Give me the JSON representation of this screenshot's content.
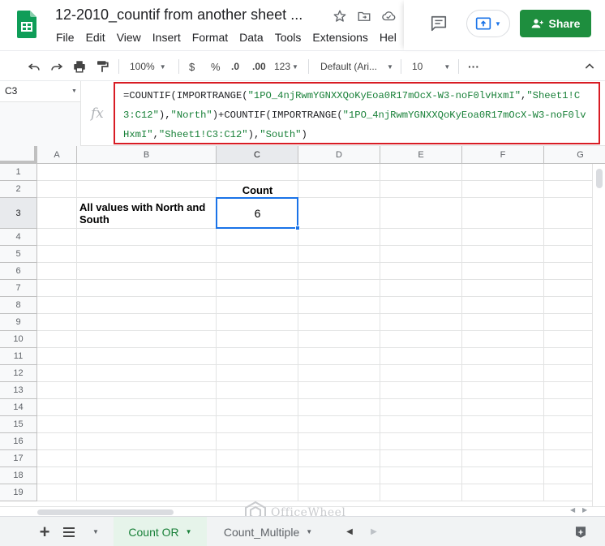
{
  "header": {
    "title": "12-2010_countif from another sheet ...",
    "menu": [
      "File",
      "Edit",
      "View",
      "Insert",
      "Format",
      "Data",
      "Tools",
      "Extensions",
      "Hel"
    ],
    "share_label": "Share",
    "icons": [
      "star-icon",
      "move-to-folder-icon",
      "cloud-status-icon",
      "comment-icon",
      "present-icon",
      "person-icon"
    ]
  },
  "toolbar": {
    "zoom": "100%",
    "currency": "$",
    "percent": "%",
    "decrease_decimals": ".0",
    "increase_decimals": ".00",
    "more_formats": "123",
    "font": "Default (Ari...",
    "font_size": "10",
    "more": "···"
  },
  "formula_bar": {
    "cell_ref": "C3",
    "fx": "fx",
    "formula_parts": [
      {
        "t": "=COUNTIF(IMPORTRANGE(",
        "c": "n"
      },
      {
        "t": "\"1PO_4njRwmYGNXXQoKyEoa0R17mOcX-W3-noF0lvHxmI\"",
        "c": "g"
      },
      {
        "t": ",",
        "c": "n"
      },
      {
        "t": "\"Sheet1!C3:C12\"",
        "c": "g"
      },
      {
        "t": "),",
        "c": "n"
      },
      {
        "t": "\"North\"",
        "c": "g"
      },
      {
        "t": ")+COUNTIF(IMPORTRANGE(",
        "c": "n"
      },
      {
        "t": "\"1PO_4njRwmYGNXXQoKyEoa0R17mOcX-W3-noF0lvHxmI\"",
        "c": "g"
      },
      {
        "t": ",",
        "c": "n"
      },
      {
        "t": "\"Sheet1!C3:C12\"",
        "c": "g"
      },
      {
        "t": "),",
        "c": "n"
      },
      {
        "t": "\"South\"",
        "c": "g"
      },
      {
        "t": ")",
        "c": "n"
      }
    ]
  },
  "grid": {
    "columns": [
      "A",
      "B",
      "C",
      "D",
      "E",
      "F",
      "G"
    ],
    "rows": [
      "1",
      "2",
      "3",
      "4",
      "5",
      "6",
      "7",
      "8",
      "9",
      "10",
      "11",
      "12",
      "13",
      "14",
      "15",
      "16",
      "17",
      "18",
      "19"
    ],
    "selected_cell": "C3",
    "cells": {
      "C2": "Count",
      "B3": "All values with North and South",
      "C3": "6"
    }
  },
  "sheets": {
    "tabs": [
      "Count OR",
      "Count_Multiple"
    ],
    "active": "Count OR"
  },
  "watermark": "OfficeWheel"
}
